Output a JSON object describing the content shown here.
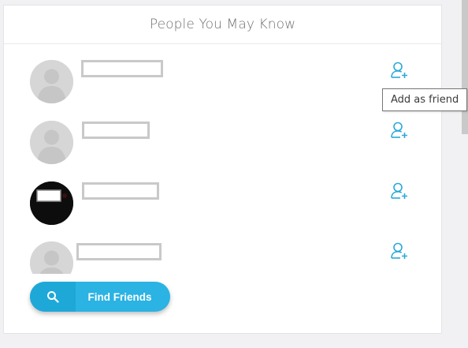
{
  "panel": {
    "title": "People You May Know",
    "tooltip": "Add as friend"
  },
  "people": [
    {
      "avatar": "default-avatar",
      "add_icon": "add-friend-icon"
    },
    {
      "avatar": "default-avatar",
      "add_icon": "add-friend-icon"
    },
    {
      "avatar": "photo-avatar",
      "add_icon": "add-friend-icon"
    },
    {
      "avatar": "default-avatar",
      "add_icon": "add-friend-icon"
    }
  ],
  "find_button": {
    "label": "Find Friends",
    "icon": "search-icon"
  },
  "colors": {
    "accent": "#2ab3e3",
    "accent_dark": "#1ea8d8",
    "icon_blue": "#2aa9d9"
  }
}
